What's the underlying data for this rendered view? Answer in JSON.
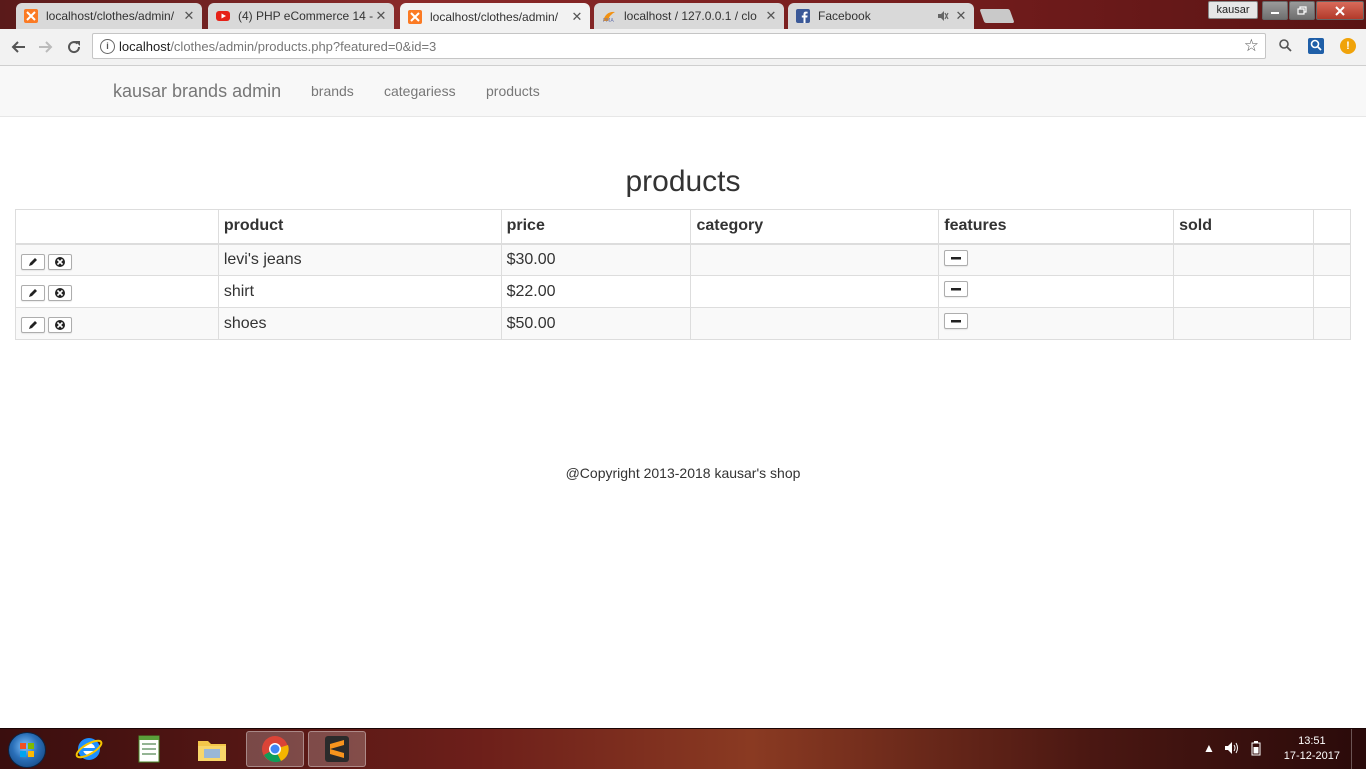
{
  "browser": {
    "tabs": [
      {
        "title": "localhost/clothes/admin/",
        "icon": "xampp-icon",
        "active": false
      },
      {
        "title": "(4) PHP eCommerce 14 -",
        "icon": "youtube-icon",
        "active": false
      },
      {
        "title": "localhost/clothes/admin/",
        "icon": "xampp-icon",
        "active": true
      },
      {
        "title": "localhost / 127.0.0.1 / clo",
        "icon": "phpmyadmin-icon",
        "active": false
      },
      {
        "title": "Facebook",
        "icon": "facebook-icon",
        "active": false
      }
    ],
    "tab_close": "✕",
    "profile_name": "kausar",
    "url_host": "localhost",
    "url_path": "/clothes/admin/products.php?featured=0&id=3"
  },
  "nav": {
    "brand": "kausar brands admin",
    "links": [
      "brands",
      "categariess",
      "products"
    ]
  },
  "page": {
    "title": "products",
    "table": {
      "headers": [
        "",
        "product",
        "price",
        "category",
        "features",
        "sold",
        ""
      ],
      "rows": [
        {
          "product": "levi's jeans",
          "price": "$30.00",
          "category": "",
          "sold": ""
        },
        {
          "product": "shirt",
          "price": "$22.00",
          "category": "",
          "sold": ""
        },
        {
          "product": "shoes",
          "price": "$50.00",
          "category": "",
          "sold": ""
        }
      ]
    },
    "footer": "@Copyright 2013-2018 kausar's shop"
  },
  "taskbar": {
    "time": "13:51",
    "date": "17-12-2017",
    "pinned": [
      "internet-explorer-icon",
      "notepad-icon",
      "file-explorer-icon",
      "chrome-icon",
      "sublime-text-icon"
    ]
  },
  "colors": {
    "navbar_bg": "#f8f8f8",
    "link_color": "#777777",
    "text_color": "#333333",
    "table_border": "#dddddd"
  }
}
